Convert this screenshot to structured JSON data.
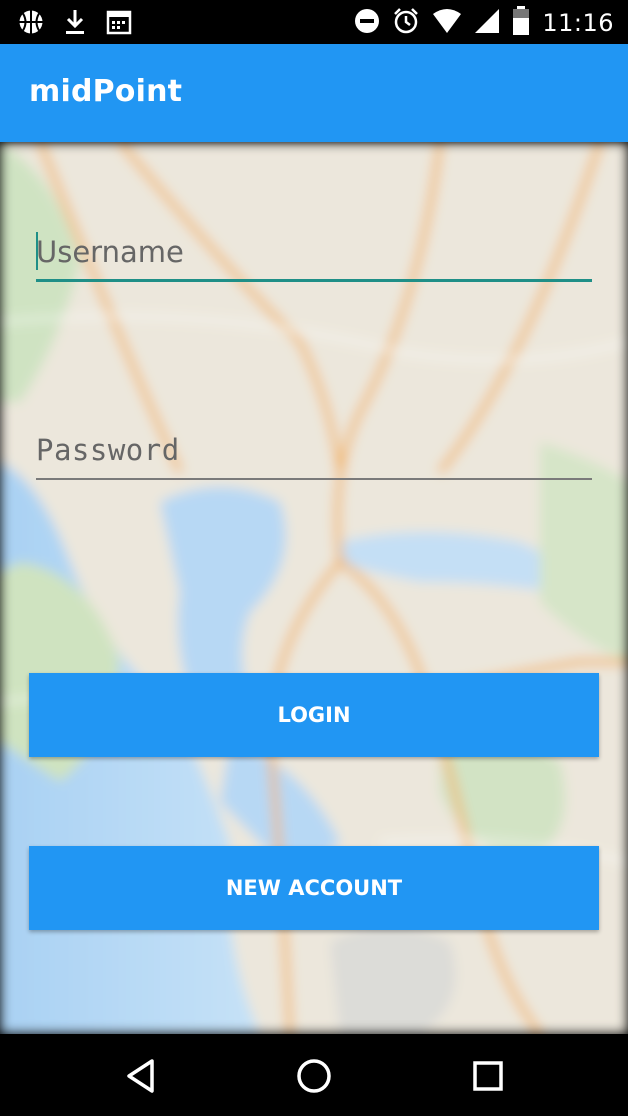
{
  "status_bar": {
    "time": "11:16",
    "left_icons": [
      "basketball-icon",
      "download-icon",
      "calendar-icon"
    ],
    "right_icons": [
      "do-not-disturb-icon",
      "alarm-icon",
      "wifi-icon",
      "signal-icon",
      "battery-icon"
    ]
  },
  "app_bar": {
    "title": "midPoint"
  },
  "form": {
    "username_placeholder": "Username",
    "username_value": "",
    "password_placeholder": "Password",
    "password_value": "",
    "login_label": "LOGIN",
    "new_account_label": "NEW ACCOUNT"
  },
  "nav_bar": {
    "icons": [
      "back-icon",
      "home-icon",
      "recents-icon"
    ]
  },
  "colors": {
    "primary": "#2196F3",
    "accent": "#1f8f87",
    "status_bar": "#000000"
  }
}
